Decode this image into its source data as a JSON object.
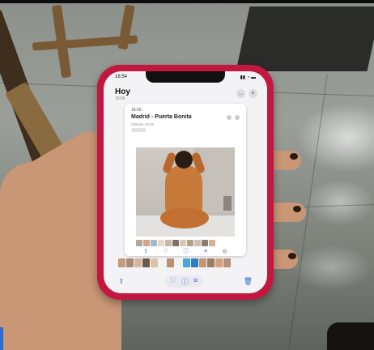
{
  "phone": {
    "status_time": "18:54",
    "header_title": "Hoy",
    "header_sub": "18:56",
    "card": {
      "time": "18:56",
      "title": "Madrid - Puerta Bonita",
      "date": "Sábado 18:55"
    }
  },
  "icons": {
    "share": "share-icon",
    "heart": "heart-icon",
    "info": "info-icon",
    "adjust": "adjust-icon",
    "trash": "trash-icon",
    "more": "ellipsis-icon",
    "close": "close-icon"
  }
}
